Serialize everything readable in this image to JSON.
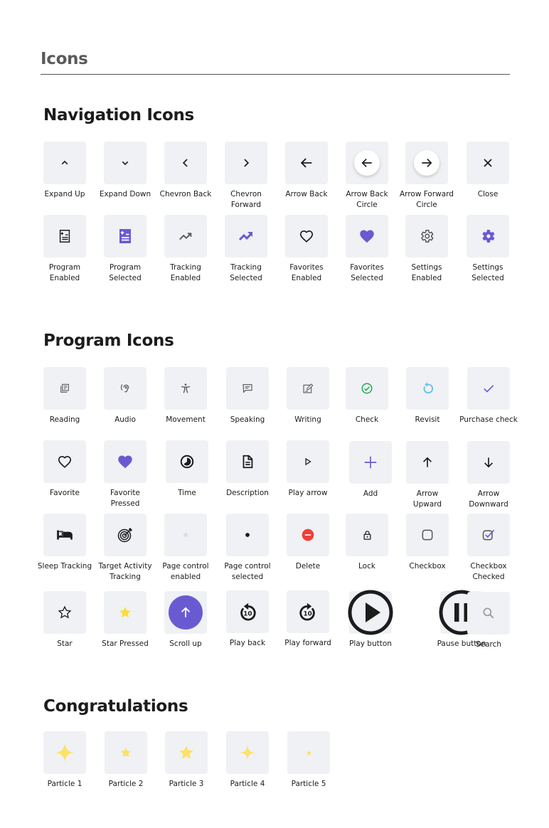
{
  "page": {
    "title": "Icons"
  },
  "colors": {
    "tile_bg": "#eff1f4",
    "accent_purple": "#6a5ad2",
    "heart_pink": "#e2638a",
    "check_green": "#22a852",
    "revisit_blue": "#6ec1e8",
    "delete_red": "#f23d3d",
    "star_yellow": "#fddc3c",
    "particle_yellow": "#fde168",
    "icon_dark": "#1c1c1c",
    "icon_grey": "#555555"
  },
  "sections": {
    "navigation": {
      "title": "Navigation Icons",
      "items": [
        {
          "label": "Expand Up",
          "icon": "chevron-up-icon"
        },
        {
          "label": "Expand Down",
          "icon": "chevron-down-icon"
        },
        {
          "label": "Chevron Back",
          "icon": "chevron-left-icon"
        },
        {
          "label": "Chevron Forward",
          "icon": "chevron-right-icon"
        },
        {
          "label": "Arrow Back",
          "icon": "arrow-left-icon"
        },
        {
          "label": "Arrow Back\nCircle",
          "icon": "arrow-left-circle-icon"
        },
        {
          "label": "Arrow Forward\nCircle",
          "icon": "arrow-right-circle-icon"
        },
        {
          "label": "Close",
          "icon": "close-icon"
        },
        {
          "label": "Program\nEnabled",
          "icon": "program-outline-icon"
        },
        {
          "label": "Program\nSelected",
          "icon": "program-filled-icon"
        },
        {
          "label": "Tracking\nEnabled",
          "icon": "trending-up-outline-icon"
        },
        {
          "label": "Tracking\nSelected",
          "icon": "trending-up-filled-icon"
        },
        {
          "label": "Favorites\nEnabled",
          "icon": "heart-outline-icon"
        },
        {
          "label": "Favorites\nSelected",
          "icon": "heart-filled-icon"
        },
        {
          "label": "Settings\nEnabled",
          "icon": "gear-outline-icon"
        },
        {
          "label": "Settings\nSelected",
          "icon": "gear-filled-icon"
        }
      ]
    },
    "program": {
      "title": "Program Icons",
      "items": [
        {
          "label": "Reading",
          "icon": "reading-icon"
        },
        {
          "label": "Audio",
          "icon": "hearing-icon"
        },
        {
          "label": "Movement",
          "icon": "movement-icon"
        },
        {
          "label": "Speaking",
          "icon": "speech-bubble-icon"
        },
        {
          "label": "Writing",
          "icon": "edit-note-icon"
        },
        {
          "label": "Check",
          "icon": "check-circle-icon"
        },
        {
          "label": "Revisit",
          "icon": "replay-icon"
        },
        {
          "label": "Purchase check",
          "icon": "checkmark-icon"
        },
        {
          "label": "Favorite",
          "icon": "heart-outline-icon"
        },
        {
          "label": "Favorite Pressed",
          "icon": "heart-filled-icon"
        },
        {
          "label": "Time",
          "icon": "time-icon"
        },
        {
          "label": "Description",
          "icon": "document-icon"
        },
        {
          "label": "Play arrow",
          "icon": "play-arrow-icon"
        },
        {
          "label": "Add",
          "icon": "plus-icon"
        },
        {
          "label": "Arrow\nUpward",
          "icon": "arrow-up-icon"
        },
        {
          "label": "Arrow\nDownward",
          "icon": "arrow-down-icon"
        },
        {
          "label": "Sleep Tracking",
          "icon": "bed-icon"
        },
        {
          "label": "Target Activity\nTracking",
          "icon": "target-icon"
        },
        {
          "label": "Page control\nenabled",
          "icon": "dot-light-icon"
        },
        {
          "label": "Page control\nselected",
          "icon": "dot-dark-icon"
        },
        {
          "label": "Delete",
          "icon": "delete-circle-icon"
        },
        {
          "label": "Lock",
          "icon": "lock-icon"
        },
        {
          "label": "Checkbox",
          "icon": "checkbox-icon"
        },
        {
          "label": "Checkbox\nChecked",
          "icon": "checkbox-checked-icon"
        },
        {
          "label": "Star",
          "icon": "star-outline-icon"
        },
        {
          "label": "Star Pressed",
          "icon": "star-filled-icon"
        },
        {
          "label": "Scroll up",
          "icon": "scroll-up-icon"
        },
        {
          "label": "Play back",
          "icon": "replay-10-icon"
        },
        {
          "label": "Play forward",
          "icon": "forward-10-icon"
        },
        {
          "label": "Play button",
          "icon": "play-circle-icon"
        },
        {
          "label": "Pause button",
          "icon": "pause-circle-icon"
        },
        {
          "label": "Search",
          "icon": "search-icon"
        }
      ]
    },
    "congratulations": {
      "title": "Congratulations",
      "items": [
        {
          "label": "Particle 1",
          "icon": "sparkle-large-icon"
        },
        {
          "label": "Particle 2",
          "icon": "star-rounded-small-icon"
        },
        {
          "label": "Particle 3",
          "icon": "star-medium-icon"
        },
        {
          "label": "Particle 4",
          "icon": "sparkle-thin-icon"
        },
        {
          "label": "Particle 5",
          "icon": "star-tiny-icon"
        }
      ]
    }
  }
}
